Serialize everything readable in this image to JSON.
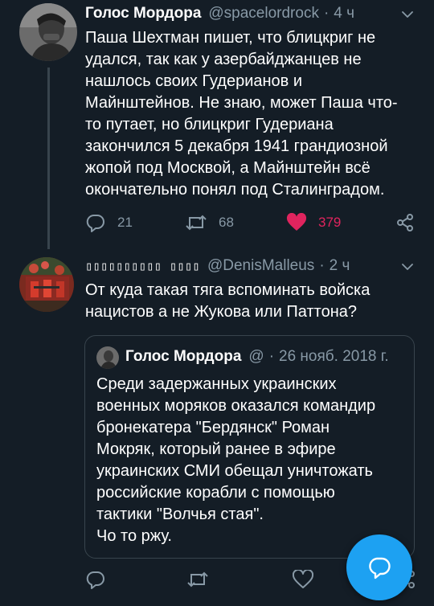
{
  "tweet1": {
    "author_name": "Голос Мордора",
    "handle": "@spacelordrock",
    "separator": "·",
    "time": "4 ч",
    "text_lines": [
      "Паша Шехтман пишет, что блицкриг не",
      "удался, так как у азербайджанцев не",
      "нашлось своих Гудерианов и",
      "Майнштейнов. Не знаю, может Паша что-",
      "то путает, но блицкриг Гудериана",
      "закончился 5 декабря 1941 грандиозной",
      "жопой под Москвой, а Майнштейн всё",
      "окончательно понял под Сталинградом."
    ],
    "replies": "21",
    "retweets": "68",
    "likes": "379",
    "liked": true
  },
  "tweet2": {
    "author_name": "▯▯▯▯▯▯▯▯▯▯ ▯▯▯▯",
    "handle": "@DenisMalleus",
    "separator": "·",
    "time": "2 ч",
    "text_lines": [
      "От куда такая тяга вспоминать войска",
      "нацистов а не Жукова или Паттона?"
    ],
    "quoted": {
      "author_name": "Голос Мордора",
      "handle": "@",
      "separator": "·",
      "date": "26 нояб. 2018 г.",
      "text_lines": [
        "Среди задержанных украинских",
        "военных моряков оказался командир",
        "бронекатера \"Бердянск\" Роман",
        "Мокряк, который ранее в эфире",
        "украинских СМИ обещал уничтожать",
        "российские корабли с помощью",
        "тактики \"Волчья стая\".",
        "Чо то ржу."
      ]
    }
  },
  "icons": {
    "reply": "reply-icon",
    "retweet": "retweet-icon",
    "like": "heart-icon",
    "share": "share-icon",
    "menu": "chevron-down-icon",
    "compose": "compose-reply-icon"
  },
  "colors": {
    "background": "#141d26",
    "accent": "#1da1f2",
    "like": "#e0245e",
    "muted": "#8899a6",
    "border": "#38444d"
  }
}
